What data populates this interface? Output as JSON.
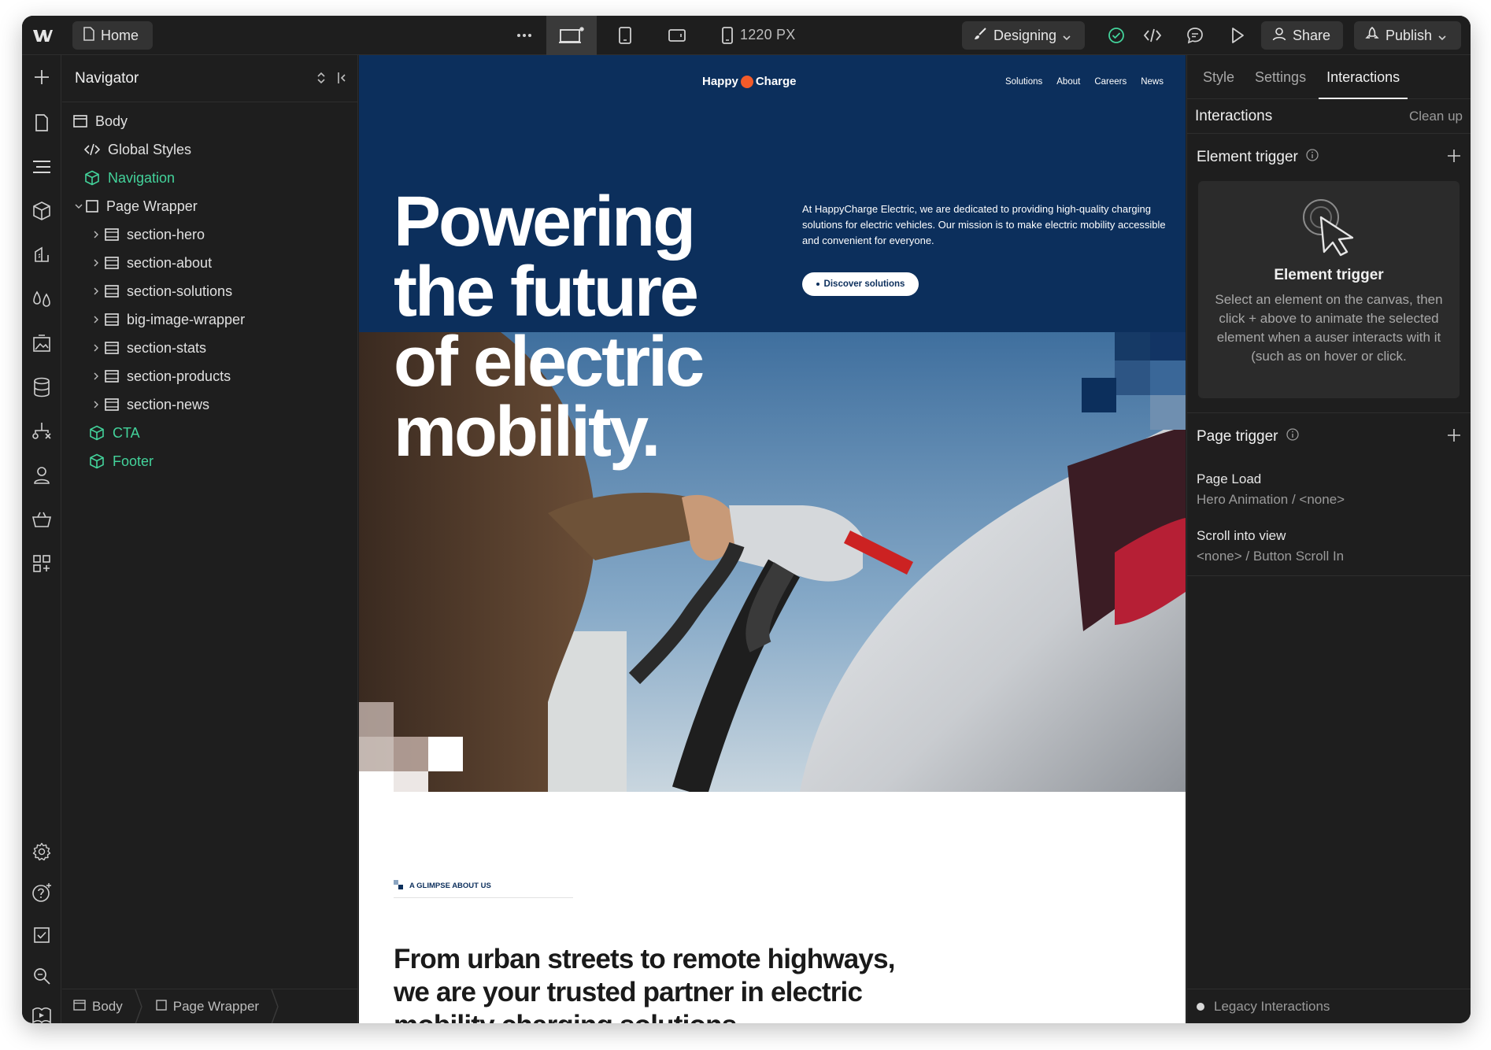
{
  "topbar": {
    "home_label": "Home",
    "width_readout": "1220 PX",
    "mode_label": "Designing",
    "share_label": "Share",
    "publish_label": "Publish"
  },
  "navigator": {
    "title": "Navigator",
    "items": [
      {
        "label": "Body"
      },
      {
        "label": "Global Styles"
      },
      {
        "label": "Navigation"
      },
      {
        "label": "Page Wrapper"
      },
      {
        "label": "section-hero"
      },
      {
        "label": "section-about"
      },
      {
        "label": "section-solutions"
      },
      {
        "label": "big-image-wrapper"
      },
      {
        "label": "section-stats"
      },
      {
        "label": "section-products"
      },
      {
        "label": "section-news"
      },
      {
        "label": "CTA"
      },
      {
        "label": "Footer"
      }
    ],
    "breadcrumb": [
      "Body",
      "Page Wrapper"
    ]
  },
  "site": {
    "logo_left": "Happy",
    "logo_right": "Charge",
    "nav": [
      "Solutions",
      "About",
      "Careers",
      "News"
    ],
    "hero_title": "Powering the future of electric mobility.",
    "hero_text": "At HappyCharge Electric, we are dedicated to providing high-quality charging solutions for electric vehicles. Our mission is to make electric mobility accessible and convenient for everyone.",
    "cta_label": "Discover solutions",
    "eyebrow": "A GLIMPSE ABOUT US",
    "about_heading": "From urban streets to remote highways, we are your trusted partner in electric mobility charging solutions"
  },
  "panel": {
    "tabs": [
      "Style",
      "Settings",
      "Interactions"
    ],
    "active_tab": "Interactions",
    "header_title": "Interactions",
    "cleanup_label": "Clean up",
    "element_trigger": {
      "title": "Element trigger",
      "card_title": "Element trigger",
      "card_desc": "Select an element on the canvas, then click + above to animate the selected element when a auser interacts with it (such as on hover or click."
    },
    "page_trigger": {
      "title": "Page trigger",
      "items": [
        {
          "name": "Page Load",
          "detail": "Hero Animation / <none>"
        },
        {
          "name": "Scroll into view",
          "detail": "<none> / Button Scroll In"
        }
      ]
    },
    "legacy_label": "Legacy Interactions"
  },
  "colors": {
    "brand_navy": "#0c2f5c",
    "component_green": "#43d39b",
    "logo_orange": "#f25b2a"
  }
}
